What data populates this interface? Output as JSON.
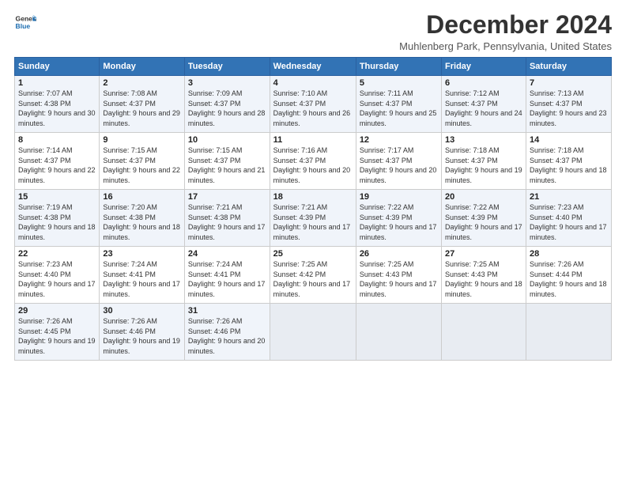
{
  "logo": {
    "line1": "General",
    "line2": "Blue"
  },
  "title": "December 2024",
  "subtitle": "Muhlenberg Park, Pennsylvania, United States",
  "days_of_week": [
    "Sunday",
    "Monday",
    "Tuesday",
    "Wednesday",
    "Thursday",
    "Friday",
    "Saturday"
  ],
  "weeks": [
    [
      {
        "day": 1,
        "rise": "7:07 AM",
        "set": "4:38 PM",
        "daylight": "9 hours and 30 minutes."
      },
      {
        "day": 2,
        "rise": "7:08 AM",
        "set": "4:37 PM",
        "daylight": "9 hours and 29 minutes."
      },
      {
        "day": 3,
        "rise": "7:09 AM",
        "set": "4:37 PM",
        "daylight": "9 hours and 28 minutes."
      },
      {
        "day": 4,
        "rise": "7:10 AM",
        "set": "4:37 PM",
        "daylight": "9 hours and 26 minutes."
      },
      {
        "day": 5,
        "rise": "7:11 AM",
        "set": "4:37 PM",
        "daylight": "9 hours and 25 minutes."
      },
      {
        "day": 6,
        "rise": "7:12 AM",
        "set": "4:37 PM",
        "daylight": "9 hours and 24 minutes."
      },
      {
        "day": 7,
        "rise": "7:13 AM",
        "set": "4:37 PM",
        "daylight": "9 hours and 23 minutes."
      }
    ],
    [
      {
        "day": 8,
        "rise": "7:14 AM",
        "set": "4:37 PM",
        "daylight": "9 hours and 22 minutes."
      },
      {
        "day": 9,
        "rise": "7:15 AM",
        "set": "4:37 PM",
        "daylight": "9 hours and 22 minutes."
      },
      {
        "day": 10,
        "rise": "7:15 AM",
        "set": "4:37 PM",
        "daylight": "9 hours and 21 minutes."
      },
      {
        "day": 11,
        "rise": "7:16 AM",
        "set": "4:37 PM",
        "daylight": "9 hours and 20 minutes."
      },
      {
        "day": 12,
        "rise": "7:17 AM",
        "set": "4:37 PM",
        "daylight": "9 hours and 20 minutes."
      },
      {
        "day": 13,
        "rise": "7:18 AM",
        "set": "4:37 PM",
        "daylight": "9 hours and 19 minutes."
      },
      {
        "day": 14,
        "rise": "7:18 AM",
        "set": "4:37 PM",
        "daylight": "9 hours and 18 minutes."
      }
    ],
    [
      {
        "day": 15,
        "rise": "7:19 AM",
        "set": "4:38 PM",
        "daylight": "9 hours and 18 minutes."
      },
      {
        "day": 16,
        "rise": "7:20 AM",
        "set": "4:38 PM",
        "daylight": "9 hours and 18 minutes."
      },
      {
        "day": 17,
        "rise": "7:21 AM",
        "set": "4:38 PM",
        "daylight": "9 hours and 17 minutes."
      },
      {
        "day": 18,
        "rise": "7:21 AM",
        "set": "4:39 PM",
        "daylight": "9 hours and 17 minutes."
      },
      {
        "day": 19,
        "rise": "7:22 AM",
        "set": "4:39 PM",
        "daylight": "9 hours and 17 minutes."
      },
      {
        "day": 20,
        "rise": "7:22 AM",
        "set": "4:39 PM",
        "daylight": "9 hours and 17 minutes."
      },
      {
        "day": 21,
        "rise": "7:23 AM",
        "set": "4:40 PM",
        "daylight": "9 hours and 17 minutes."
      }
    ],
    [
      {
        "day": 22,
        "rise": "7:23 AM",
        "set": "4:40 PM",
        "daylight": "9 hours and 17 minutes."
      },
      {
        "day": 23,
        "rise": "7:24 AM",
        "set": "4:41 PM",
        "daylight": "9 hours and 17 minutes."
      },
      {
        "day": 24,
        "rise": "7:24 AM",
        "set": "4:41 PM",
        "daylight": "9 hours and 17 minutes."
      },
      {
        "day": 25,
        "rise": "7:25 AM",
        "set": "4:42 PM",
        "daylight": "9 hours and 17 minutes."
      },
      {
        "day": 26,
        "rise": "7:25 AM",
        "set": "4:43 PM",
        "daylight": "9 hours and 17 minutes."
      },
      {
        "day": 27,
        "rise": "7:25 AM",
        "set": "4:43 PM",
        "daylight": "9 hours and 18 minutes."
      },
      {
        "day": 28,
        "rise": "7:26 AM",
        "set": "4:44 PM",
        "daylight": "9 hours and 18 minutes."
      }
    ],
    [
      {
        "day": 29,
        "rise": "7:26 AM",
        "set": "4:45 PM",
        "daylight": "9 hours and 19 minutes."
      },
      {
        "day": 30,
        "rise": "7:26 AM",
        "set": "4:46 PM",
        "daylight": "9 hours and 19 minutes."
      },
      {
        "day": 31,
        "rise": "7:26 AM",
        "set": "4:46 PM",
        "daylight": "9 hours and 20 minutes."
      },
      null,
      null,
      null,
      null
    ]
  ],
  "labels": {
    "sunrise": "Sunrise:",
    "sunset": "Sunset:",
    "daylight": "Daylight:"
  }
}
